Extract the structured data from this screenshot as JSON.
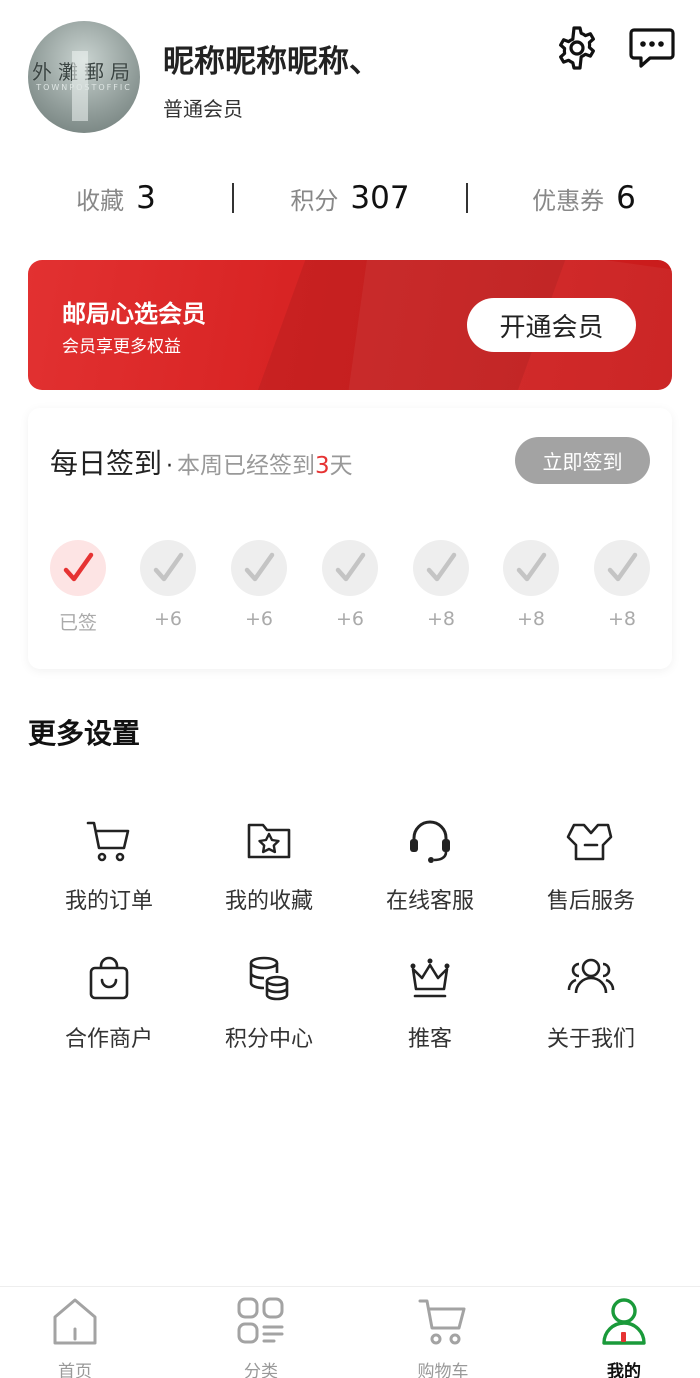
{
  "profile": {
    "nickname": "昵称昵称昵称、",
    "level": "普通会员",
    "avatar_sign": "外灘郵局",
    "avatar_sub": "TOWNPOSTOFFIC"
  },
  "stats": [
    {
      "label": "收藏",
      "value": "3"
    },
    {
      "label": "积分",
      "value": "307"
    },
    {
      "label": "优惠券",
      "value": "6"
    }
  ],
  "vip": {
    "title": "邮局心选会员",
    "subtitle": "会员享更多权益",
    "button": "开通会员"
  },
  "checkin": {
    "title": "每日签到",
    "dot": "·",
    "status_prefix": "本周已经签到",
    "status_days": "3",
    "status_suffix": "天",
    "button": "立即签到",
    "days": [
      {
        "label": "已签",
        "signed": true
      },
      {
        "label": "+6",
        "signed": false
      },
      {
        "label": "+6",
        "signed": false
      },
      {
        "label": "+6",
        "signed": false
      },
      {
        "label": "+8",
        "signed": false
      },
      {
        "label": "+8",
        "signed": false
      },
      {
        "label": "+8",
        "signed": false
      }
    ]
  },
  "more_settings": {
    "title": "更多设置",
    "items": [
      {
        "label": "我的订单",
        "icon": "cart-icon"
      },
      {
        "label": "我的收藏",
        "icon": "star-folder-icon"
      },
      {
        "label": "在线客服",
        "icon": "headset-icon"
      },
      {
        "label": "售后服务",
        "icon": "after-sales-icon"
      },
      {
        "label": "合作商户",
        "icon": "shopping-bag-icon"
      },
      {
        "label": "积分中心",
        "icon": "coins-icon"
      },
      {
        "label": "推客",
        "icon": "crown-icon"
      },
      {
        "label": "关于我们",
        "icon": "users-icon"
      }
    ]
  },
  "tabbar": [
    {
      "label": "首页",
      "icon": "home-icon",
      "active": false
    },
    {
      "label": "分类",
      "icon": "category-icon",
      "active": false
    },
    {
      "label": "购物车",
      "icon": "cart-icon",
      "active": false
    },
    {
      "label": "我的",
      "icon": "profile-icon",
      "active": true
    }
  ],
  "colors": {
    "brand_red": "#d92424",
    "active_green": "#1a9a3a",
    "checked_red": "#e63333"
  }
}
